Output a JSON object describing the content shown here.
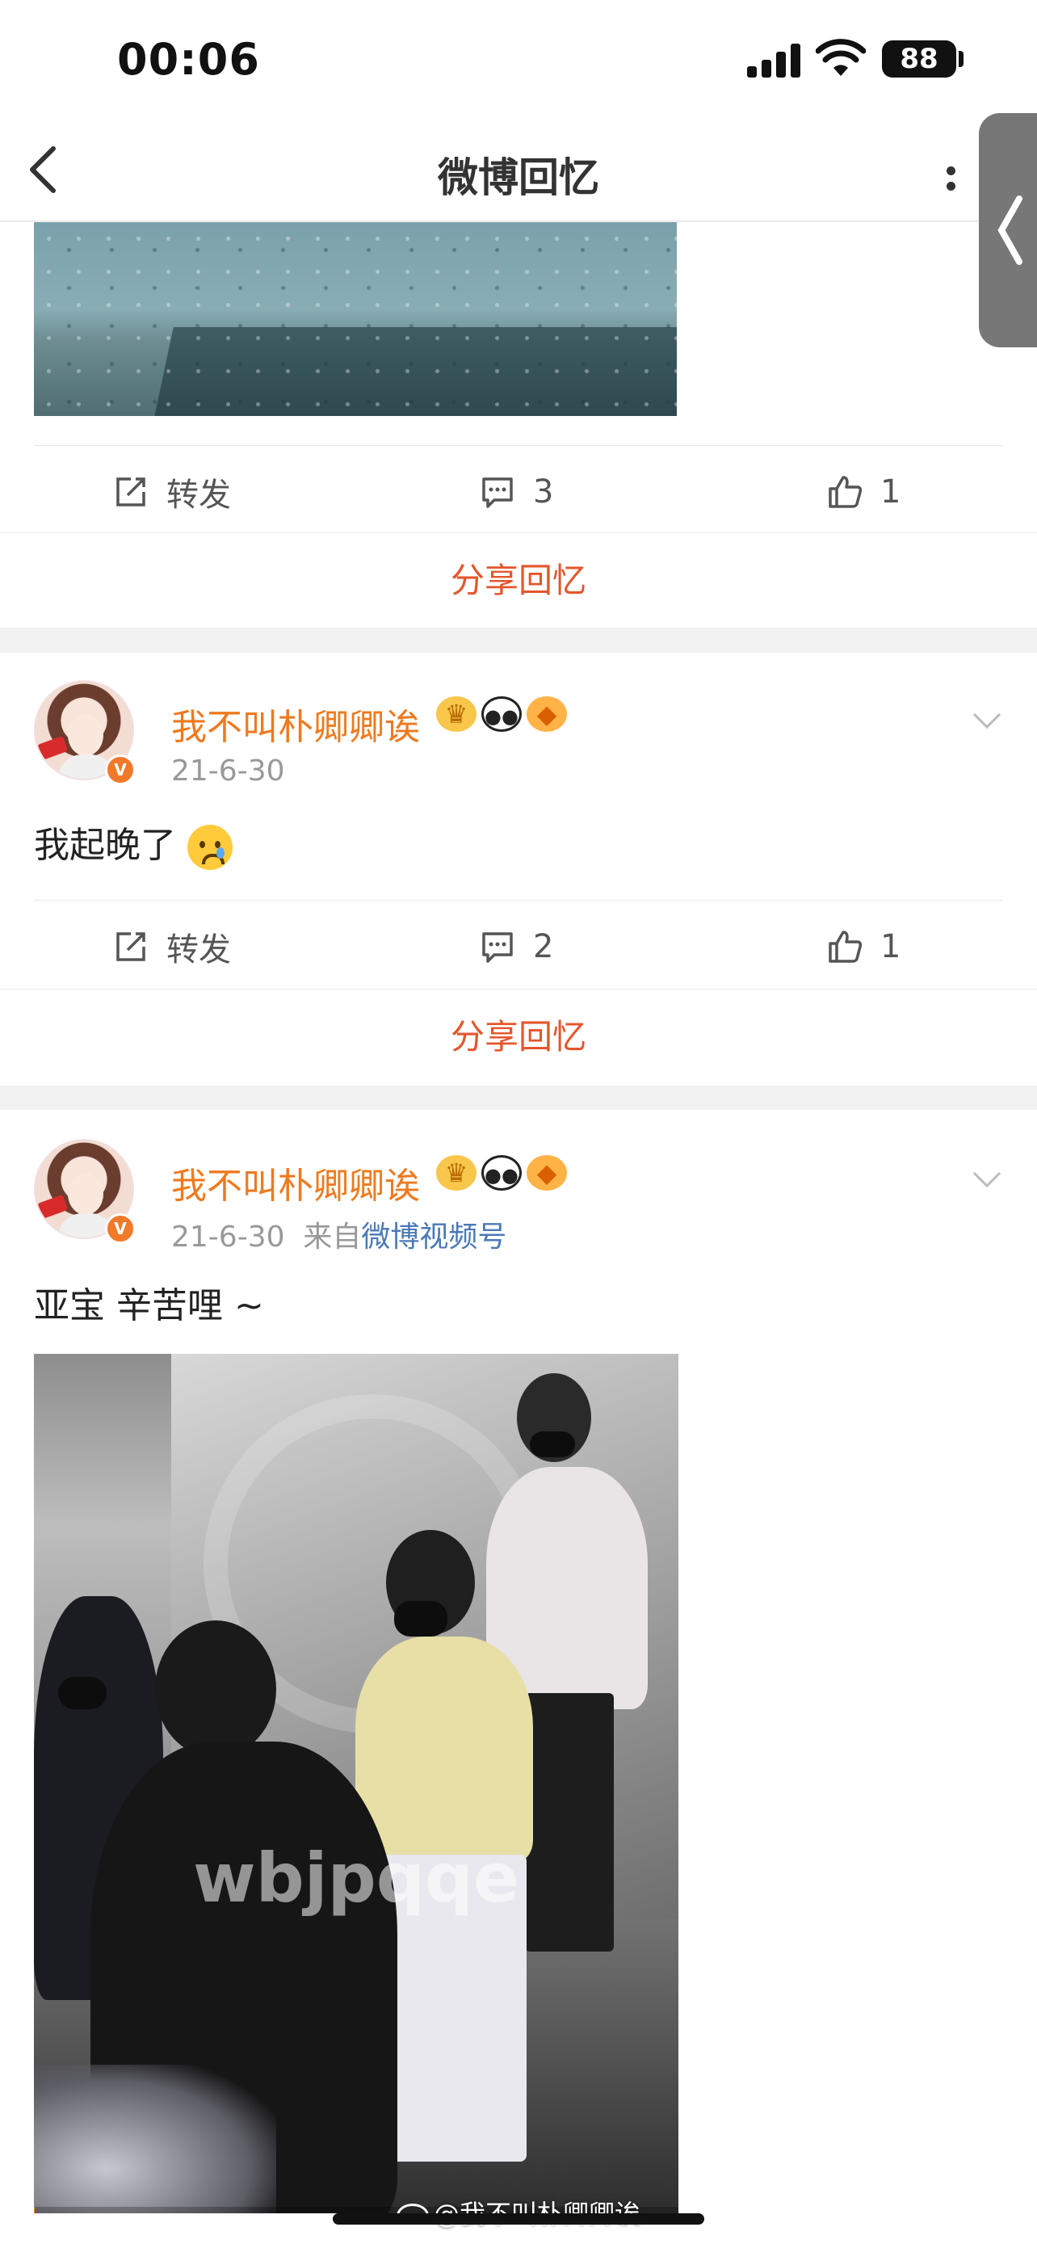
{
  "status_bar": {
    "time": "00:06",
    "battery": "88"
  },
  "nav": {
    "title": "微博回忆"
  },
  "posts": [
    {
      "actions": {
        "repost_label": "转发",
        "comment_count": "3",
        "like_count": "1"
      },
      "share_label": "分享回忆"
    },
    {
      "username": "我不叫朴卿卿诶",
      "date": "21-6-30",
      "text": "我起晚了",
      "emoji": "crying-face",
      "actions": {
        "repost_label": "转发",
        "comment_count": "2",
        "like_count": "1"
      },
      "share_label": "分享回忆"
    },
    {
      "username": "我不叫朴卿卿诶",
      "date": "21-6-30",
      "source_prefix": "来自",
      "source": "微博视频号",
      "text": "亚宝 辛苦哩 ~",
      "video_watermark": "wbjpqqe"
    }
  ],
  "user_badges": [
    "crown-badge",
    "panda-badge",
    "fish-badge"
  ],
  "bottom_watermark": "@我不叫朴卿卿诶",
  "colors": {
    "accent": "#e5562d",
    "username": "#ee7a1f",
    "link": "#4b79b5",
    "verified": "#f07a2a"
  }
}
